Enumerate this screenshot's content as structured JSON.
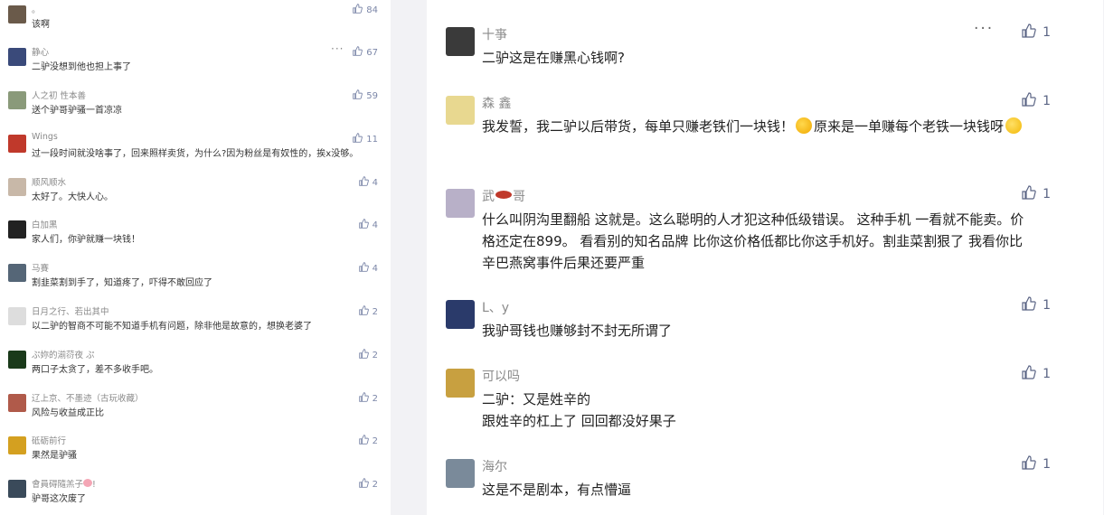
{
  "icons": {
    "like": "thumbs-up-icon",
    "more": "more-dots-icon"
  },
  "colors": {
    "like": "#7b86a8",
    "like_right": "#5b6585",
    "name": "#8a8a8a",
    "text": "#222222"
  },
  "left_comments": [
    {
      "name": "。",
      "text": "该啊",
      "likes": "84",
      "avatar_color": "#6a5a4a"
    },
    {
      "name": "静心",
      "text": "二驴没想到他也担上事了",
      "likes": "67",
      "avatar_color": "#3a4a7a",
      "more": "···"
    },
    {
      "name": "人之初 性本善",
      "text": "送个驴哥驴骚一首凉凉",
      "likes": "59",
      "avatar_color": "#8a9a7a"
    },
    {
      "name": "Wings",
      "text": "过一段时间就没啥事了，回来照样卖货，为什么?因为粉丝是有奴性的，挨x没够。",
      "likes": "11",
      "avatar_color": "#c0392b"
    },
    {
      "name": "顺风顺水",
      "text": "太好了。大快人心。",
      "likes": "4",
      "avatar_color": "#c8b8a8"
    },
    {
      "name": "白加黑",
      "text": "家人们，你驴就赚一块钱！",
      "likes": "4",
      "avatar_color": "#222222"
    },
    {
      "name": "马賽",
      "text": "割韭菜割到手了，知道疼了，吓得不敢回应了",
      "likes": "4",
      "avatar_color": "#556677"
    },
    {
      "name": "日月之行、若出其中",
      "text": "以二驴的智商不可能不知道手机有问题，除非他是故意的，想换老婆了",
      "likes": "2",
      "avatar_color": "#dddddd"
    },
    {
      "name": "ぷ妳的湔葕夜 ぷ",
      "text": "两口子太贪了，差不多收手吧。",
      "likes": "2",
      "avatar_color": "#1a3a1a"
    },
    {
      "name": "辽上京、不墨迹（古玩收藏）",
      "text": "风险与收益成正比",
      "likes": "2",
      "avatar_color": "#b05a4a"
    },
    {
      "name": "砥砺前行",
      "text": "果然是驴骚",
      "likes": "2",
      "avatar_color": "#d4a020"
    },
    {
      "name": "會員碍隨羔子",
      "text": "驴哥这次废了",
      "likes": "2",
      "avatar_color": "#3a4a5a",
      "name_suffix": "!"
    }
  ],
  "right_comments": [
    {
      "name": "十亊",
      "text": "二驴这是在赚黑心钱啊?",
      "likes": "1",
      "avatar_color": "#3a3a3a",
      "more": "···"
    },
    {
      "name": "森 鑫",
      "text_before": "我发誓，我二驴以后带货，每单只赚老铁们一块钱！",
      "text_after": "原来是一单赚每个老铁一块钱呀",
      "likes": "1",
      "avatar_color": "#e8d890"
    },
    {
      "name_before": "武",
      "name_after": "哥",
      "text": "什么叫阴沟里翻船 这就是。这么聪明的人才犯这种低级错误。 这种手机 一看就不能卖。价格还定在899。 看看别的知名品牌 比你这价格低都比你这手机好。割韭菜割狠了  我看你比辛巴燕窝事件后果还要严重",
      "likes": "1",
      "avatar_color": "#b8b0c8"
    },
    {
      "name": "L、y",
      "text": "我驴哥钱也赚够封不封无所谓了",
      "likes": "1",
      "avatar_color": "#2a3a6a"
    },
    {
      "name": "可以吗",
      "text_line1": "二驴：又是姓辛的",
      "text_line2": "跟姓辛的杠上了  回回都没好果子",
      "likes": "1",
      "avatar_color": "#c8a040"
    },
    {
      "name": "海尔",
      "text": "这是不是剧本，有点懵逼",
      "likes": "1",
      "avatar_color": "#7a8a9a"
    }
  ]
}
